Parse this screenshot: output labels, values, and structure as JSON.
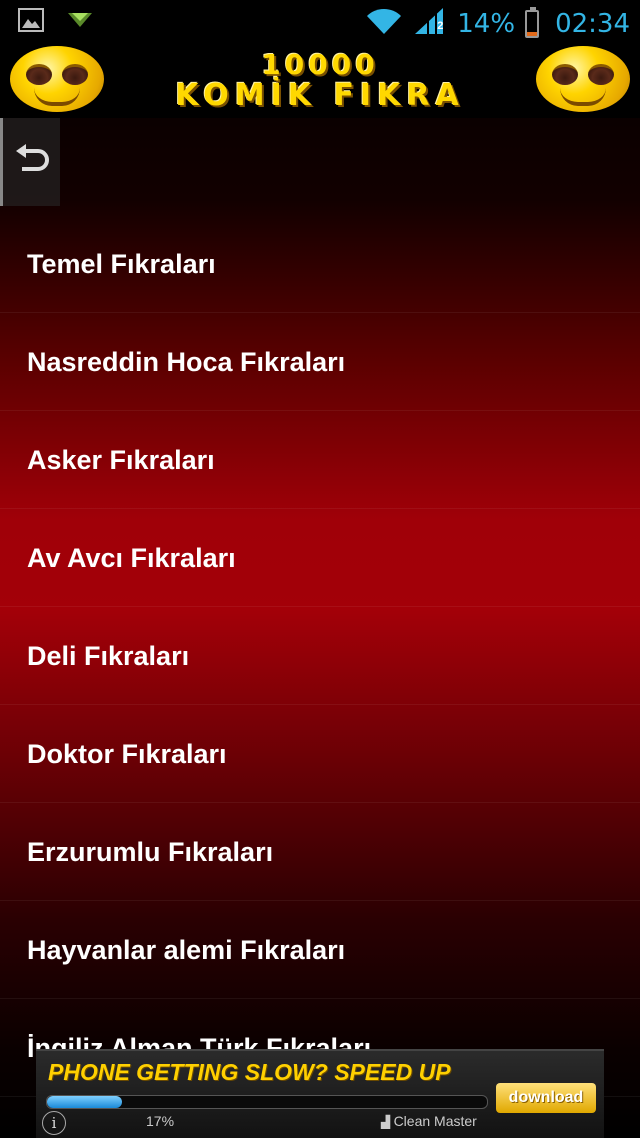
{
  "status_bar": {
    "battery_percent": "14%",
    "time": "02:34",
    "network_badge": "2",
    "icons": [
      "image-icon",
      "download-arrow-icon",
      "wifi-icon",
      "signal-icon",
      "battery-icon"
    ]
  },
  "banner": {
    "line1": "10000",
    "line2": "KOMİK FIKRA"
  },
  "back_button": {
    "icon": "back-arrow-icon"
  },
  "categories": [
    "Temel Fıkraları",
    "Nasreddin Hoca Fıkraları",
    "Asker Fıkraları",
    "Av Avcı Fıkraları",
    "Deli Fıkraları",
    "Doktor Fıkraları",
    "Erzurumlu Fıkraları",
    "Hayvanlar alemi Fıkraları",
    "İngiliz Alman Türk Fıkraları"
  ],
  "ad": {
    "headline": "PHONE GETTING SLOW?  SPEED UP",
    "progress": 0.17,
    "progress_label": "17%",
    "brand": "Clean Master",
    "button_label": "download",
    "info_label": "i"
  },
  "colors": {
    "accent_blue": "#33b5e5",
    "gold": "#ffd800",
    "list_red": "#a00008"
  }
}
